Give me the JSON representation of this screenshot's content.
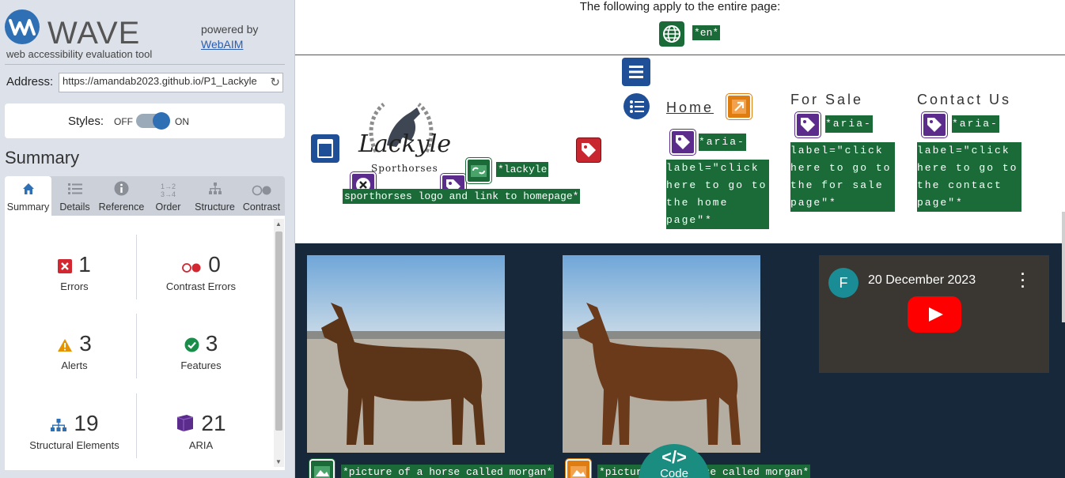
{
  "wave": {
    "logo_text": "WAVE",
    "logo_sub": "web accessibility evaluation tool",
    "powered_by": "powered by",
    "powered_link": "WebAIM",
    "address_label": "Address:",
    "address_value": "https://amandab2023.github.io/P1_Lackyle",
    "styles_label": "Styles:",
    "styles_off": "OFF",
    "styles_on": "ON",
    "styles_state": "on",
    "summary_heading": "Summary",
    "tabs": [
      {
        "label": "Summary",
        "icon": "home-icon",
        "active": true
      },
      {
        "label": "Details",
        "icon": "list-icon",
        "active": false
      },
      {
        "label": "Reference",
        "icon": "info-icon",
        "active": false
      },
      {
        "label": "Order",
        "icon": "order-icon",
        "active": false
      },
      {
        "label": "Structure",
        "icon": "structure-icon",
        "active": false
      },
      {
        "label": "Contrast",
        "icon": "contrast-icon",
        "active": false
      }
    ],
    "stats": {
      "errors": {
        "count": "1",
        "label": "Errors",
        "color": "#d22630"
      },
      "contrast_errors": {
        "count": "0",
        "label": "Contrast Errors",
        "color": "#d22630"
      },
      "alerts": {
        "count": "3",
        "label": "Alerts",
        "color": "#e59400"
      },
      "features": {
        "count": "3",
        "label": "Features",
        "color": "#1a8d4a"
      },
      "structural": {
        "count": "19",
        "label": "Structural Elements",
        "color": "#2f6fb4"
      },
      "aria": {
        "count": "21",
        "label": "ARIA",
        "color": "#5b2c8c"
      }
    }
  },
  "page": {
    "top_text": "The following apply to the entire page:",
    "lang_tag": "*en*",
    "logo_word": "Lackyle",
    "logo_sub": "Sporthorses",
    "logo_tag_1": "*lackyle",
    "logo_tag_2": "sporthorses logo and link to homepage*",
    "nav": [
      {
        "label": "Home",
        "aria_lines": [
          "*aria-",
          "label=\"click",
          "here to go to",
          "the home",
          "page\"*"
        ]
      },
      {
        "label": "For Sale",
        "aria_lines": [
          "*aria-",
          "label=\"click",
          "here to go to",
          "the for sale",
          "page\"*"
        ]
      },
      {
        "label": "Contact Us",
        "aria_lines": [
          "*aria-",
          "label=\"click",
          "here to go to",
          "the contact",
          "page\"*"
        ]
      }
    ],
    "photo_tag_1": "*picture of a horse called morgan*",
    "photo_tag_2": "*picture of a horse called morgan*",
    "video_avatar": "F",
    "video_title": "20 December 2023",
    "code_label": "Code",
    "colors": {
      "tag_green": "#1a6b38",
      "aria_purple": "#5b2c8c",
      "structure_blue": "#1f4f97",
      "dark_bg": "#162839"
    }
  }
}
